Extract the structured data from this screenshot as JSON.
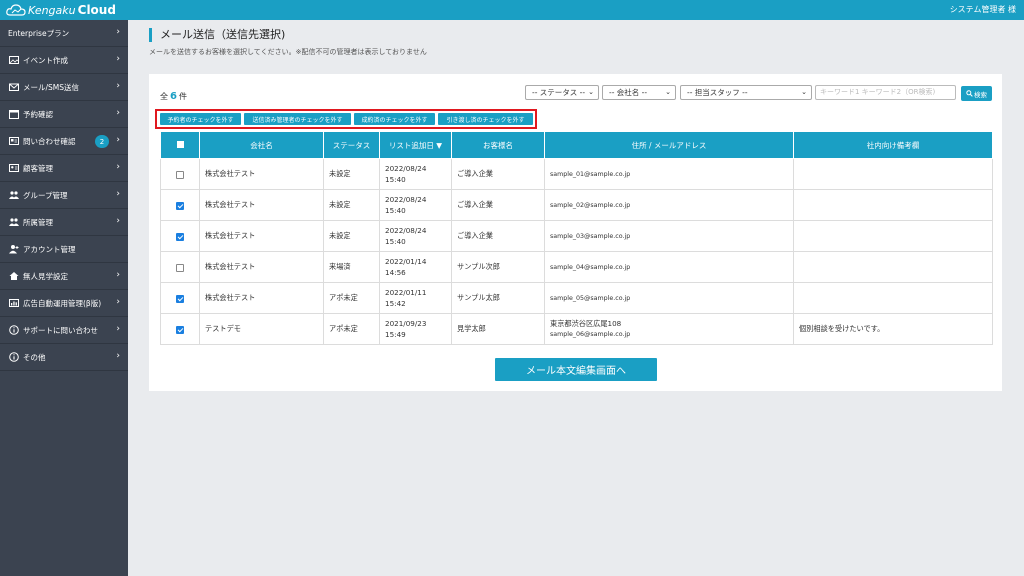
{
  "header": {
    "logo_kengaku": "Kengaku",
    "logo_cloud": "Cloud",
    "user": "システム管理者 様"
  },
  "sidebar": {
    "items": [
      {
        "label": "Enterpriseプラン",
        "icon": "none"
      },
      {
        "label": "イベント作成",
        "icon": "image-icon"
      },
      {
        "label": "メール/SMS送信",
        "icon": "mail-icon"
      },
      {
        "label": "予約確認",
        "icon": "calendar-icon"
      },
      {
        "label": "問い合わせ確認",
        "icon": "inbox-icon",
        "badge": "2"
      },
      {
        "label": "顧客管理",
        "icon": "id-card-icon"
      },
      {
        "label": "グループ管理",
        "icon": "users-icon"
      },
      {
        "label": "所属管理",
        "icon": "users-icon"
      },
      {
        "label": "アカウント管理",
        "icon": "user-plus-icon"
      },
      {
        "label": "無人見学設定",
        "icon": "home-icon"
      },
      {
        "label": "広告自動運用管理(β版)",
        "icon": "chart-icon"
      },
      {
        "label": "サポートに問い合わせ",
        "icon": "info-icon"
      },
      {
        "label": "その他",
        "icon": "info-icon"
      }
    ]
  },
  "page": {
    "title": "メール送信（送信先選択)",
    "description": "メールを送信するお客様を選択してください。※配信不可の管理者は表示しておりません"
  },
  "count": {
    "prefix": "全",
    "value": "6",
    "suffix": "件"
  },
  "filters": {
    "status": "-- ステータス --",
    "company": "-- 会社名 --",
    "staff": "-- 担当スタッフ --",
    "keyword_placeholder": "キーワード1 キーワード2（OR検索)",
    "search_label": "検索"
  },
  "quick_buttons": [
    "予約者のチェックを外す",
    "送信済み管理者のチェックを外す",
    "成約済のチェックを外す",
    "引き渡し済のチェックを外す"
  ],
  "table": {
    "headers": [
      "会社名",
      "ステータス",
      "リスト追加日 ▼",
      "お客様名",
      "住所 / メールアドレス",
      "社内向け備考欄"
    ],
    "rows": [
      {
        "checked": false,
        "company": "株式会社テスト",
        "status": "未設定",
        "date": "2022/08/24",
        "time": "15:40",
        "name": "ご導入企業",
        "address": "",
        "email": "sample_01@sample.co.jp",
        "note": ""
      },
      {
        "checked": true,
        "company": "株式会社テスト",
        "status": "未設定",
        "date": "2022/08/24",
        "time": "15:40",
        "name": "ご導入企業",
        "address": "",
        "email": "sample_02@sample.co.jp",
        "note": ""
      },
      {
        "checked": true,
        "company": "株式会社テスト",
        "status": "未設定",
        "date": "2022/08/24",
        "time": "15:40",
        "name": "ご導入企業",
        "address": "",
        "email": "sample_03@sample.co.jp",
        "note": ""
      },
      {
        "checked": false,
        "company": "株式会社テスト",
        "status": "来場済",
        "date": "2022/01/14",
        "time": "14:56",
        "name": "サンプル次郎",
        "address": "",
        "email": "sample_04@sample.co.jp",
        "note": ""
      },
      {
        "checked": true,
        "company": "株式会社テスト",
        "status": "アポ未定",
        "date": "2022/01/11",
        "time": "15:42",
        "name": "サンプル太郎",
        "address": "",
        "email": "sample_05@sample.co.jp",
        "note": ""
      },
      {
        "checked": true,
        "company": "テストデモ",
        "status": "アポ未定",
        "date": "2021/09/23",
        "time": "15:49",
        "name": "見学太郎",
        "address": "東京都渋谷区広尾108",
        "email": "sample_06@sample.co.jp",
        "note": "個別相談を受けたいです。"
      }
    ]
  },
  "main_button": "メール本文編集画面へ"
}
